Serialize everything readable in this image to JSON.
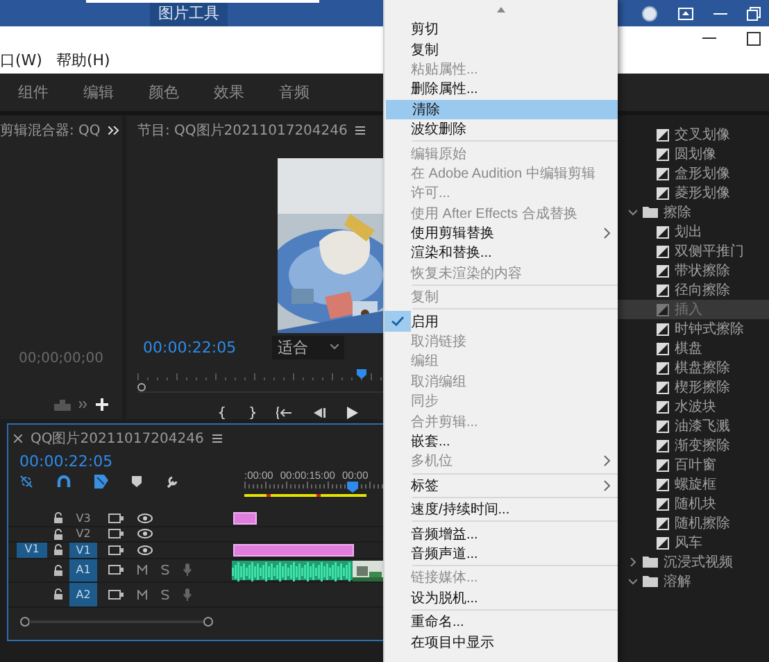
{
  "title_bar": {
    "tab": "图片工具"
  },
  "menu_bar": {
    "items": [
      "口(W)",
      "帮助(H)"
    ]
  },
  "workspaces": [
    "组件",
    "编辑",
    "颜色",
    "效果",
    "音频"
  ],
  "mixer_panel": {
    "title": "剪辑混合器: QQ",
    "timecode": "00;00;00;00"
  },
  "program_monitor": {
    "title": "节目: QQ图片20211017204246",
    "timecode": "00:00:22:05",
    "zoom": "适合",
    "level": 0.96
  },
  "timeline": {
    "title": "QQ图片20211017204246",
    "timecode": "00:00:22:05",
    "ruler_labels": [
      ":00:00",
      "00:00:15:00",
      "00:00"
    ],
    "tracks": [
      {
        "name": "V3",
        "kind": "video",
        "targeted": false,
        "clips": [
          {
            "kind": "still"
          }
        ]
      },
      {
        "name": "V2",
        "kind": "video",
        "targeted": false
      },
      {
        "name": "V1",
        "kind": "video",
        "targeted": true,
        "source": "V1",
        "clips": [
          {
            "kind": "video"
          }
        ]
      },
      {
        "name": "A1",
        "kind": "audio",
        "targeted": true,
        "clips": [
          {
            "kind": "audio"
          },
          {
            "kind": "picture"
          }
        ]
      },
      {
        "name": "A2",
        "kind": "audio",
        "targeted": true
      }
    ]
  },
  "effects_panel": {
    "items": [
      {
        "kind": "effect",
        "label": "交叉划像",
        "selected": false
      },
      {
        "kind": "effect",
        "label": "圆划像",
        "selected": false
      },
      {
        "kind": "effect",
        "label": "盒形划像",
        "selected": false
      },
      {
        "kind": "effect",
        "label": "菱形划像",
        "selected": false
      },
      {
        "kind": "folder",
        "label": "擦除",
        "expanded": true,
        "children": [
          {
            "kind": "effect",
            "label": "划出",
            "selected": false
          },
          {
            "kind": "effect",
            "label": "双侧平推门",
            "selected": false
          },
          {
            "kind": "effect",
            "label": "带状擦除",
            "selected": false
          },
          {
            "kind": "effect",
            "label": "径向擦除",
            "selected": false
          },
          {
            "kind": "effect",
            "label": "插入",
            "selected": true
          },
          {
            "kind": "effect",
            "label": "时钟式擦除",
            "selected": false
          },
          {
            "kind": "effect",
            "label": "棋盘",
            "selected": false
          },
          {
            "kind": "effect",
            "label": "棋盘擦除",
            "selected": false
          },
          {
            "kind": "effect",
            "label": "楔形擦除",
            "selected": false
          },
          {
            "kind": "effect",
            "label": "水波块",
            "selected": false
          },
          {
            "kind": "effect",
            "label": "油漆飞溅",
            "selected": false
          },
          {
            "kind": "effect",
            "label": "渐变擦除",
            "selected": false
          },
          {
            "kind": "effect",
            "label": "百叶窗",
            "selected": false
          },
          {
            "kind": "effect",
            "label": "螺旋框",
            "selected": false
          },
          {
            "kind": "effect",
            "label": "随机块",
            "selected": false
          },
          {
            "kind": "effect",
            "label": "随机擦除",
            "selected": false
          },
          {
            "kind": "effect",
            "label": "风车",
            "selected": false
          }
        ]
      },
      {
        "kind": "folder",
        "label": "沉浸式视频",
        "expanded": false
      },
      {
        "kind": "folder",
        "label": "溶解",
        "expanded": true
      }
    ]
  },
  "context_menu": {
    "items": [
      {
        "kind": "item",
        "label": "剪切",
        "disabled": false,
        "selected": false,
        "checked": false,
        "submenu": false
      },
      {
        "kind": "item",
        "label": "复制",
        "disabled": false,
        "selected": false,
        "checked": false,
        "submenu": false
      },
      {
        "kind": "item",
        "label": "粘贴属性...",
        "disabled": true,
        "selected": false,
        "checked": false,
        "submenu": false
      },
      {
        "kind": "item",
        "label": "删除属性...",
        "disabled": false,
        "selected": false,
        "checked": false,
        "submenu": false
      },
      {
        "kind": "item",
        "label": "清除",
        "disabled": false,
        "selected": true,
        "checked": false,
        "submenu": false
      },
      {
        "kind": "item",
        "label": "波纹删除",
        "disabled": false,
        "selected": false,
        "checked": false,
        "submenu": false
      },
      {
        "kind": "separator"
      },
      {
        "kind": "item",
        "label": "编辑原始",
        "disabled": true,
        "selected": false,
        "checked": false,
        "submenu": false
      },
      {
        "kind": "item",
        "label": "在 Adobe Audition 中编辑剪辑",
        "disabled": true,
        "selected": false,
        "checked": false,
        "submenu": false
      },
      {
        "kind": "item",
        "label": "许可...",
        "disabled": true,
        "selected": false,
        "checked": false,
        "submenu": false
      },
      {
        "kind": "item",
        "label": "使用 After Effects 合成替换",
        "disabled": true,
        "selected": false,
        "checked": false,
        "submenu": false
      },
      {
        "kind": "item",
        "label": "使用剪辑替换",
        "disabled": false,
        "selected": false,
        "checked": false,
        "submenu": true
      },
      {
        "kind": "item",
        "label": "渲染和替换...",
        "disabled": false,
        "selected": false,
        "checked": false,
        "submenu": false
      },
      {
        "kind": "item",
        "label": "恢复未渲染的内容",
        "disabled": true,
        "selected": false,
        "checked": false,
        "submenu": false
      },
      {
        "kind": "separator"
      },
      {
        "kind": "item",
        "label": "复制",
        "disabled": true,
        "selected": false,
        "checked": false,
        "submenu": false
      },
      {
        "kind": "separator"
      },
      {
        "kind": "item",
        "label": "启用",
        "disabled": false,
        "selected": false,
        "checked": true,
        "submenu": false
      },
      {
        "kind": "item",
        "label": "取消链接",
        "disabled": true,
        "selected": false,
        "checked": false,
        "submenu": false
      },
      {
        "kind": "item",
        "label": "编组",
        "disabled": true,
        "selected": false,
        "checked": false,
        "submenu": false
      },
      {
        "kind": "item",
        "label": "取消编组",
        "disabled": true,
        "selected": false,
        "checked": false,
        "submenu": false
      },
      {
        "kind": "item",
        "label": "同步",
        "disabled": true,
        "selected": false,
        "checked": false,
        "submenu": false
      },
      {
        "kind": "item",
        "label": "合并剪辑...",
        "disabled": true,
        "selected": false,
        "checked": false,
        "submenu": false
      },
      {
        "kind": "item",
        "label": "嵌套...",
        "disabled": false,
        "selected": false,
        "checked": false,
        "submenu": false
      },
      {
        "kind": "item",
        "label": "多机位",
        "disabled": true,
        "selected": false,
        "checked": false,
        "submenu": true
      },
      {
        "kind": "separator"
      },
      {
        "kind": "item",
        "label": "标签",
        "disabled": false,
        "selected": false,
        "checked": false,
        "submenu": true
      },
      {
        "kind": "separator"
      },
      {
        "kind": "item",
        "label": "速度/持续时间...",
        "disabled": false,
        "selected": false,
        "checked": false,
        "submenu": false
      },
      {
        "kind": "separator"
      },
      {
        "kind": "item",
        "label": "音频增益...",
        "disabled": false,
        "selected": false,
        "checked": false,
        "submenu": false
      },
      {
        "kind": "item",
        "label": "音频声道...",
        "disabled": false,
        "selected": false,
        "checked": false,
        "submenu": false
      },
      {
        "kind": "separator"
      },
      {
        "kind": "item",
        "label": "链接媒体...",
        "disabled": true,
        "selected": false,
        "checked": false,
        "submenu": false
      },
      {
        "kind": "item",
        "label": "设为脱机...",
        "disabled": false,
        "selected": false,
        "checked": false,
        "submenu": false
      },
      {
        "kind": "separator"
      },
      {
        "kind": "item",
        "label": "重命名...",
        "disabled": false,
        "selected": false,
        "checked": false,
        "submenu": false
      },
      {
        "kind": "item",
        "label": "在项目中显示",
        "disabled": false,
        "selected": false,
        "checked": false,
        "submenu": false
      }
    ]
  }
}
